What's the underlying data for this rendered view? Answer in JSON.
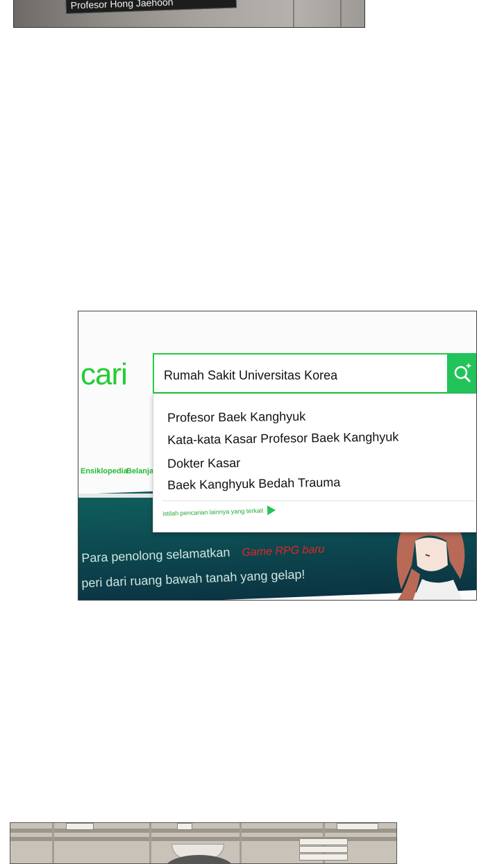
{
  "top_panel": {
    "sign_text": "Profesor Hong Jaehoon"
  },
  "search_screen": {
    "logo_text": "cari",
    "search": {
      "value": "Rumah Sakit Universitas Korea",
      "button_icon": "search-icon"
    },
    "suggestions": [
      "Profesor Baek Kanghyuk",
      "Kata-kata Kasar Profesor Baek Kanghyuk",
      "Dokter Kasar",
      "Baek Kanghyuk Bedah Trauma"
    ],
    "more_link": "istilah pencarian lainnya yang terkait",
    "nav": [
      "Ensiklopedia",
      "Belanja"
    ],
    "banner": {
      "line1": "Para penolong selamatkan",
      "tag": "Game RPG baru",
      "line2": "peri dari ruang bawah tanah yang gelap!"
    },
    "colors": {
      "accent_green": "#22cc44",
      "banner_teal": "#0f5f5c",
      "tag_red": "#e62424"
    }
  }
}
